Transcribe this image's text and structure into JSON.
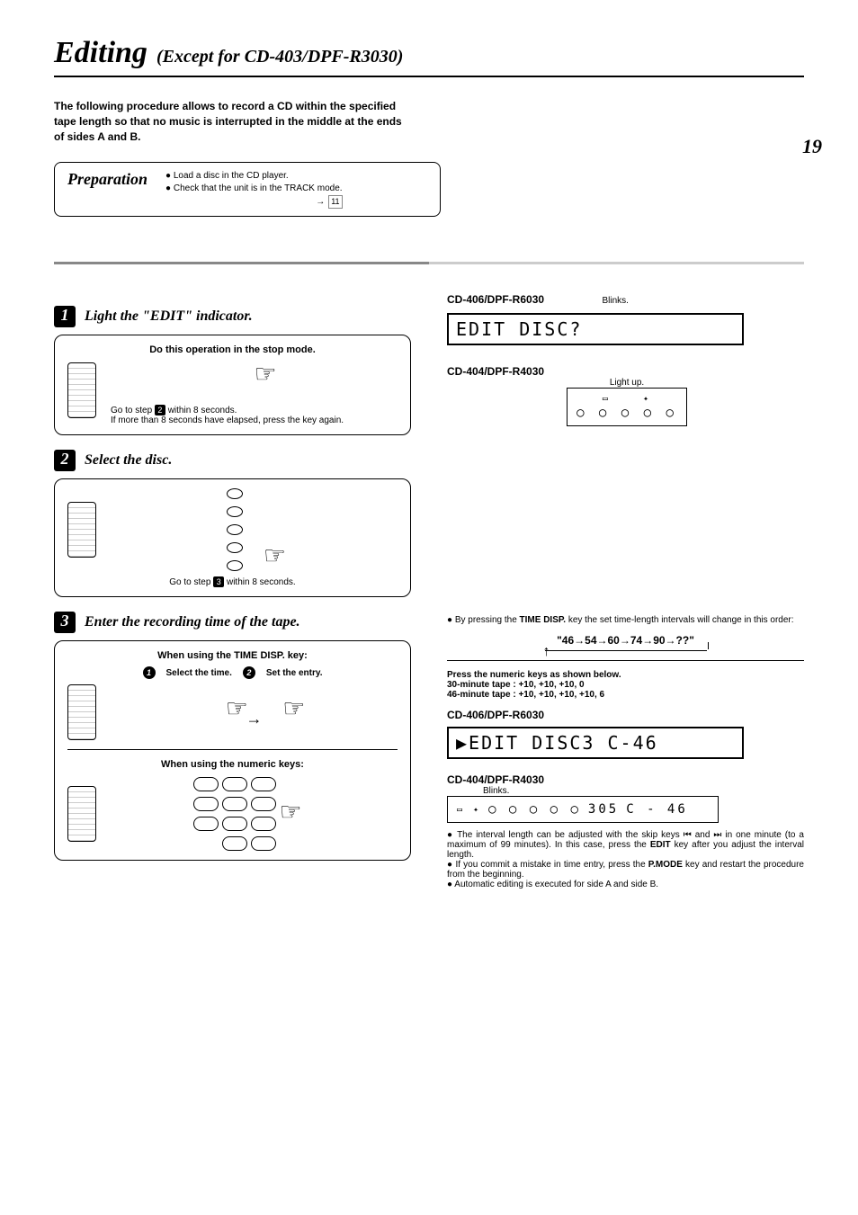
{
  "page_number": "19",
  "title": {
    "main": "Editing",
    "sub": "(Except for CD-403/DPF-R3030)"
  },
  "intro": "The following procedure allows to record a CD within the specified tape length so that no music is interrupted in the middle at the ends of sides A and B.",
  "preparation": {
    "heading": "Preparation",
    "items": [
      "Load a disc in the CD player.",
      "Check that the unit is in the  TRACK  mode."
    ],
    "ref_arrow": "→",
    "ref": "11"
  },
  "steps": {
    "s1": {
      "num": "1",
      "title": "Light the \"EDIT\" indicator.",
      "instruction": "Do this operation in the stop mode.",
      "note_a": "Go to step",
      "note_badge": "2",
      "note_b": "within 8 seconds.",
      "note_c": "If more than 8 seconds have elapsed, press the key again."
    },
    "s2": {
      "num": "2",
      "title": "Select the disc.",
      "note_a": "Go to step",
      "note_badge": "3",
      "note_b": "within 8 seconds."
    },
    "s3": {
      "num": "3",
      "title": "Enter the recording time of the tape.",
      "time_key_heading": "When using the TIME DISP. key:",
      "sub1_label": "Select the time.",
      "sub2_label": "Set the entry.",
      "numeric_heading": "When using the numeric keys:"
    }
  },
  "right": {
    "model1": "CD-406/DPF-R6030",
    "blinks": "Blinks.",
    "display1": "EDIT  DISC?",
    "model2": "CD-404/DPF-R4030",
    "lightup": "Light up.",
    "time_disp_note_a": "By pressing the ",
    "time_disp_bold": "TIME DISP.",
    "time_disp_note_b": " key the set time-length intervals will change in this order:",
    "sequence": "\"46→54→60→74→90→??\"",
    "numeric_heading": "Press the numeric keys as shown below.",
    "tape30": "30-minute tape   :  +10, +10, +10, 0",
    "tape46": "46-minute tape   :  +10, +10, +10, +10, 6",
    "model3": "CD-406/DPF-R6030",
    "display2": "▶EDIT  DISC3  C-46",
    "model4": "CD-404/DPF-R4030",
    "blinks2": "Blinks.",
    "display3_left": "○ ○ ○ ○ ○",
    "display3_num": "305",
    "display3_right": "C - 46",
    "bullets": {
      "b1a": "The interval length can be adjusted with the skip keys ⏮ and ⏭ in one minute (to a maximum of 99 minutes). In this case, press the ",
      "b1bold": "EDIT",
      "b1b": " key after you adjust the interval length.",
      "b2a": "If you commit a mistake in time entry, press the ",
      "b2bold": "P.MODE",
      "b2b": " key and restart the procedure from the beginning.",
      "b3": "Automatic editing is executed for side A and side B."
    }
  }
}
